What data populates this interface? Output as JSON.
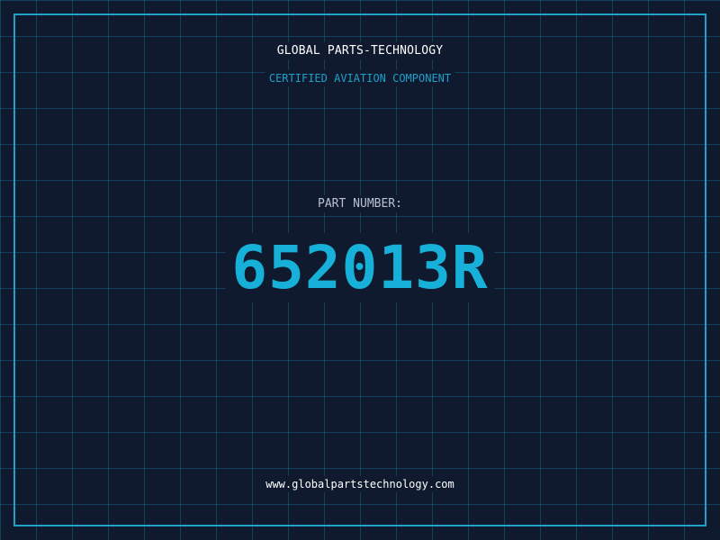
{
  "header": {
    "company_name": "GLOBAL PARTS-TECHNOLOGY",
    "tagline": "CERTIFIED AVIATION COMPONENT"
  },
  "part": {
    "label": "PART NUMBER:",
    "number": "652013R"
  },
  "footer": {
    "url": "www.globalpartstechnology.com"
  },
  "colors": {
    "background": "#101a2e",
    "grid": "#1e8cb4",
    "accent": "#1ea0c8",
    "part_number": "#16b0d8",
    "text_primary": "#ffffff",
    "text_muted": "#b8c2d0"
  }
}
